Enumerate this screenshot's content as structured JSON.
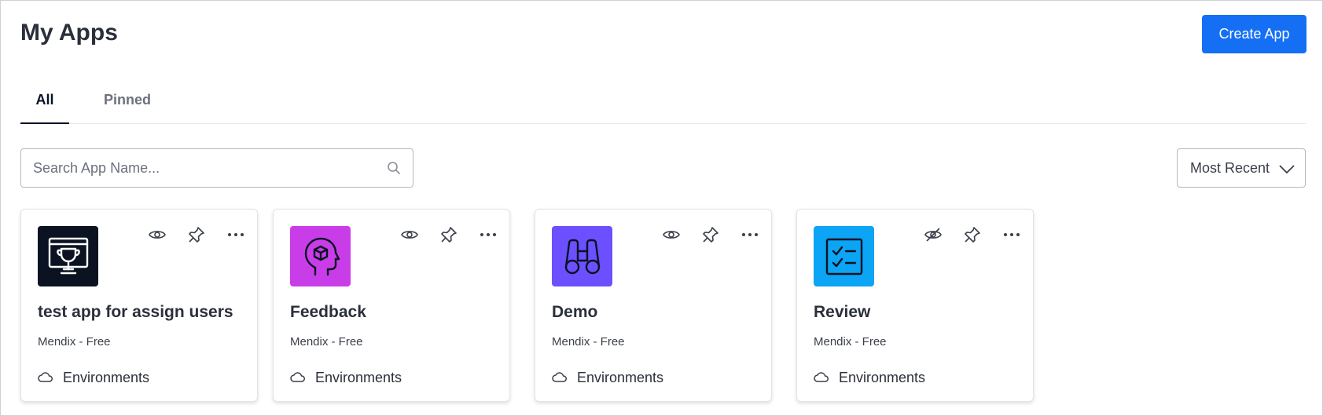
{
  "header": {
    "title": "My Apps",
    "create_label": "Create App",
    "create_color": "#146ff4"
  },
  "tabs": [
    {
      "label": "All",
      "active": true
    },
    {
      "label": "Pinned",
      "active": false
    }
  ],
  "search": {
    "placeholder": "Search App Name...",
    "value": ""
  },
  "sort": {
    "selected": "Most Recent"
  },
  "apps": [
    {
      "name": "test app for assign users",
      "meta": "Mendix - Free",
      "environments_label": "Environments",
      "icon": "trophy-screen-icon",
      "icon_bg": "#0b1322",
      "visibility": "visible"
    },
    {
      "name": "Feedback",
      "meta": "Mendix - Free",
      "environments_label": "Environments",
      "icon": "head-cube-icon",
      "icon_bg": "#c93de8",
      "visibility": "visible"
    },
    {
      "name": "Demo",
      "meta": "Mendix - Free",
      "environments_label": "Environments",
      "icon": "binoculars-icon",
      "icon_bg": "#6c4fff",
      "visibility": "visible"
    },
    {
      "name": "Review",
      "meta": "Mendix - Free",
      "environments_label": "Environments",
      "icon": "checklist-icon",
      "icon_bg": "#0ca4f4",
      "visibility": "hidden"
    }
  ]
}
